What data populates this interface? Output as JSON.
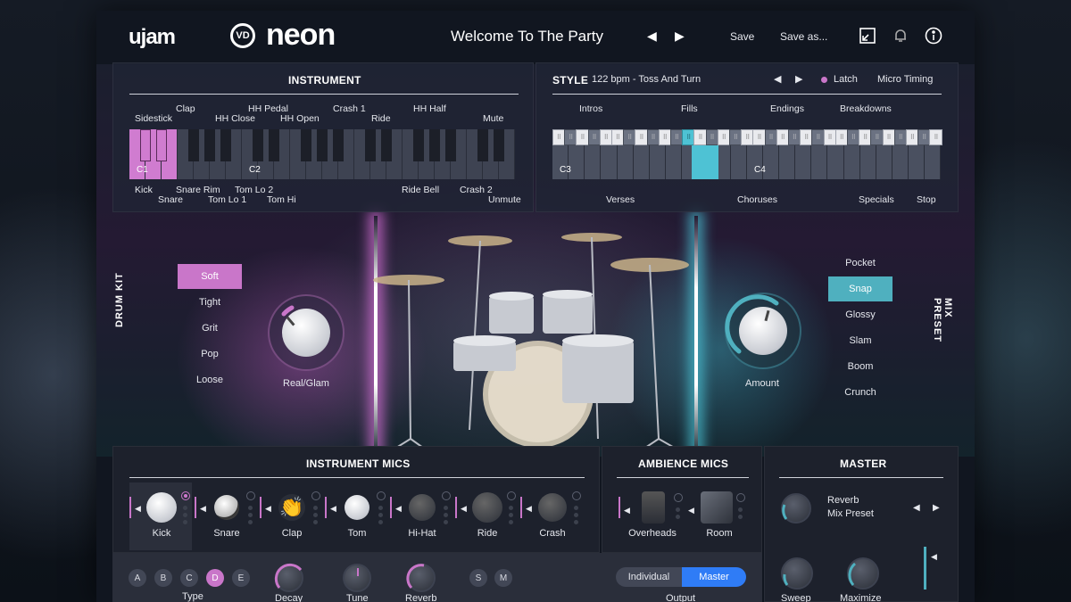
{
  "header": {
    "brand": "ujam",
    "product_mark": "VD",
    "product": "neon",
    "preset_name": "Welcome To The Party",
    "prev_arrow": "◀",
    "next_arrow": "▶",
    "save_label": "Save",
    "save_as_label": "Save as...",
    "icons": [
      "resize-icon",
      "bell-icon",
      "info-icon"
    ]
  },
  "instrument": {
    "title": "INSTRUMENT",
    "top_labels": [
      "Sidestick",
      "Clap",
      "HH Close",
      "HH Pedal",
      "HH Open",
      "Crash 1",
      "Ride",
      "HH Half",
      "Mute"
    ],
    "bottom_labels": [
      "Kick",
      "Snare",
      "Snare Rim",
      "Tom Lo 1",
      "Tom Lo 2",
      "Tom Hi",
      "Ride Bell",
      "Crash 2",
      "Unmute"
    ],
    "octaves": [
      "C1",
      "C2"
    ]
  },
  "style": {
    "title": "STYLE",
    "info": "122 bpm - Toss And Turn",
    "latch_label": "Latch",
    "micro_timing_label": "Micro Timing",
    "top_groups": [
      "Intros",
      "Fills",
      "Endings",
      "Breakdowns"
    ],
    "bottom_groups": [
      "Verses",
      "Choruses",
      "Specials",
      "Stop"
    ],
    "octaves": [
      "C3",
      "C4"
    ],
    "accent": "#4ec2d4"
  },
  "drum_kit": {
    "label": "DRUM KIT",
    "options": [
      "Soft",
      "Tight",
      "Grit",
      "Pop",
      "Loose"
    ],
    "selected": "Soft",
    "knob_label": "Real/Glam",
    "knob_value": 0.12,
    "accent": "#c976c9"
  },
  "mix_preset": {
    "label": "MIX PRESET",
    "options": [
      "Pocket",
      "Snap",
      "Glossy",
      "Slam",
      "Boom",
      "Crunch"
    ],
    "selected": "Snap",
    "knob_label": "Amount",
    "knob_value": 0.45,
    "accent": "#4fb0bf"
  },
  "instrument_mics": {
    "title": "INSTRUMENT MICS",
    "mics": [
      "Kick",
      "Snare",
      "Clap",
      "Tom",
      "Hi-Hat",
      "Ride",
      "Crash"
    ],
    "selected": "Kick"
  },
  "ambience_mics": {
    "title": "AMBIENCE MICS",
    "mics": [
      "Overheads",
      "Room"
    ]
  },
  "master": {
    "title": "MASTER",
    "reverb_label": "Reverb",
    "mix_preset_label": "Mix Preset",
    "sweep_label": "Sweep",
    "maximize_label": "Maximize"
  },
  "footer": {
    "types": [
      "A",
      "B",
      "C",
      "D",
      "E"
    ],
    "selected_type": "D",
    "type_label": "Type",
    "decay_label": "Decay",
    "tune_label": "Tune",
    "reverb_label": "Reverb",
    "solo_label": "S",
    "mute_label": "M",
    "individual_label": "Individual",
    "master_label": "Master",
    "output_label": "Output"
  }
}
